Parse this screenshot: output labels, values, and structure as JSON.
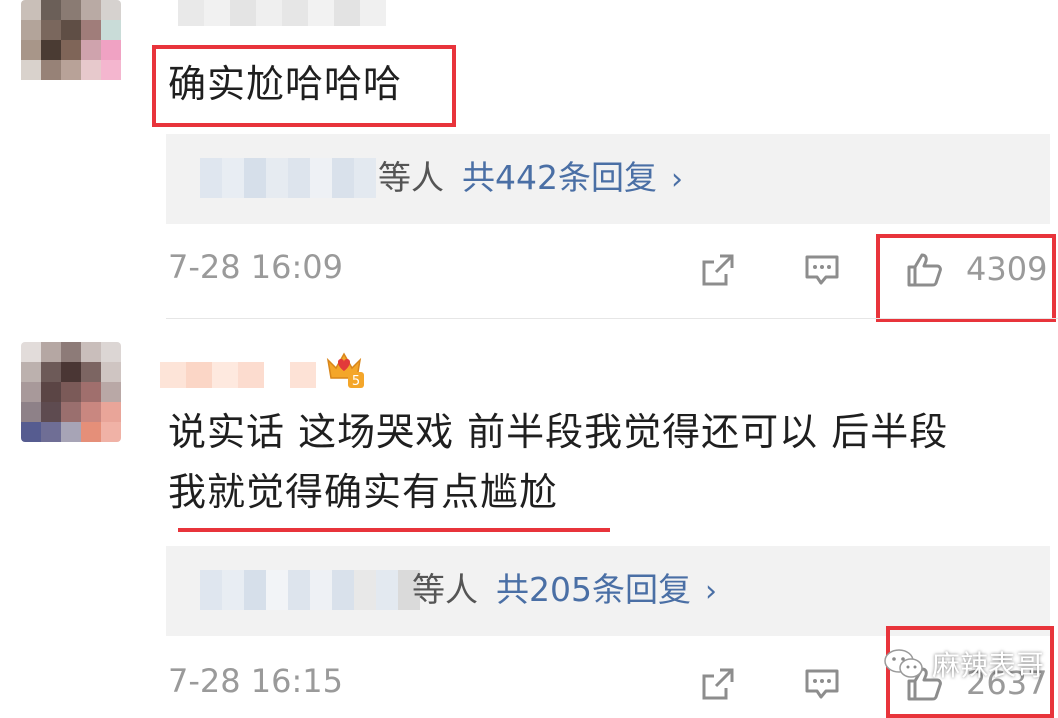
{
  "comments": [
    {
      "text": "确实尬哈哈哈",
      "replies": {
        "suffix": "等人",
        "link": "共442条回复",
        "chevron": "›"
      },
      "timestamp": "7-28 16:09",
      "like_count": "4309",
      "icons": {
        "share": "share-icon",
        "comment": "comment-icon",
        "like": "thumbs-up-icon"
      }
    },
    {
      "text_line1": "说实话 这场哭戏 前半段我觉得还可以 后半段",
      "text_line2": "我就觉得确实有点尴尬",
      "badge": "5",
      "replies": {
        "suffix": "等人",
        "link": "共205条回复",
        "chevron": "›"
      },
      "timestamp": "7-28 16:15",
      "like_count": "2637",
      "icons": {
        "share": "share-icon",
        "comment": "comment-icon",
        "like": "thumbs-up-icon"
      }
    }
  ],
  "watermark": {
    "text": "麻辣表哥",
    "icon": "wechat-icon"
  },
  "colors": {
    "highlight_red": "#e8343b",
    "link_blue": "#4a6fa5",
    "muted_gray": "#9a9a9a",
    "reply_bg": "#f2f2f2"
  }
}
